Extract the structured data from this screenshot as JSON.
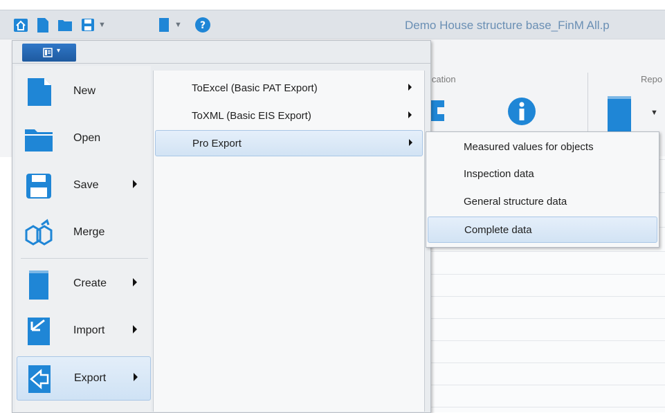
{
  "window": {
    "title": "Demo House structure base_FinM All.p"
  },
  "ribbon": {
    "group_application_label": "ication",
    "group_report_label": "Repo"
  },
  "app_menu": {
    "items": [
      {
        "label": "New"
      },
      {
        "label": "Open"
      },
      {
        "label": "Save"
      },
      {
        "label": "Merge"
      },
      {
        "label": "Create"
      },
      {
        "label": "Import"
      },
      {
        "label": "Export"
      }
    ]
  },
  "export_submenu": {
    "items": [
      {
        "label": "ToExcel (Basic PAT Export)"
      },
      {
        "label": "ToXML (Basic EIS Export)"
      },
      {
        "label": "Pro Export"
      }
    ]
  },
  "pro_export_submenu": {
    "items": [
      {
        "label": "Measured values for objects"
      },
      {
        "label": "Inspection data"
      },
      {
        "label": "General structure data"
      },
      {
        "label": "Complete data"
      }
    ]
  },
  "colors": {
    "accent": "#1f86d6",
    "selection": "#d2e3f4",
    "title_text": "#6a8fb4"
  }
}
